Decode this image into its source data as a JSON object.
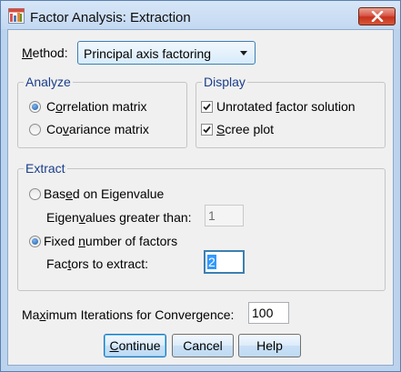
{
  "window": {
    "title": "Factor Analysis: Extraction",
    "icons": {
      "app": "spss-dialog-icon",
      "close": "close-icon"
    },
    "colors": {
      "accent": "#3399ff",
      "group_title": "#1a3e8a",
      "close": "#c7321d"
    }
  },
  "method": {
    "label_pre": "",
    "label_accel": "M",
    "label_post": "ethod:",
    "selected": "Principal axis factoring"
  },
  "analyze": {
    "title": "Analyze",
    "options": [
      {
        "pre": "C",
        "accel": "o",
        "post": "rrelation matrix",
        "checked": true
      },
      {
        "pre": "Co",
        "accel": "v",
        "post": "ariance matrix",
        "checked": false
      }
    ]
  },
  "display": {
    "title": "Display",
    "options": [
      {
        "pre": "Unrotated ",
        "accel": "f",
        "post": "actor solution",
        "checked": true
      },
      {
        "pre": "",
        "accel": "S",
        "post": "cree plot",
        "checked": true
      }
    ]
  },
  "extract": {
    "title": "Extract",
    "eigen_option": {
      "pre": "Bas",
      "accel": "e",
      "post": "d on Eigenvalue",
      "checked": false
    },
    "eigen_label": {
      "pre": "Eigen",
      "accel": "v",
      "post": "alues greater than:"
    },
    "eigen_value": "1",
    "fixed_option": {
      "pre": "Fixed ",
      "accel": "n",
      "post": "umber of factors",
      "checked": true
    },
    "factors_label": {
      "pre": "Fac",
      "accel": "t",
      "post": "ors to extract:"
    },
    "factors_value": "2"
  },
  "iterations": {
    "label": {
      "pre": "Ma",
      "accel": "x",
      "post": "imum Iterations for Convergence:"
    },
    "value": "100"
  },
  "buttons": {
    "continue": {
      "pre": "",
      "accel": "C",
      "post": "ontinue"
    },
    "cancel": "Cancel",
    "help": "Help"
  }
}
